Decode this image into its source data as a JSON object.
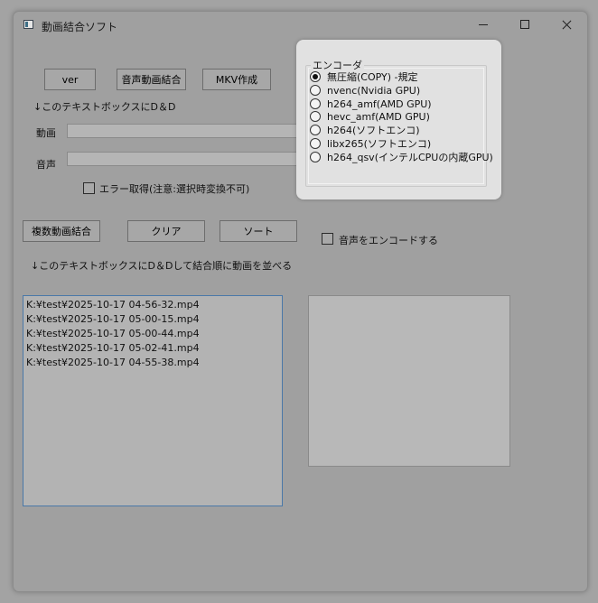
{
  "window": {
    "title": "動画結合ソフト",
    "icon": "app-window-icon"
  },
  "top_buttons": {
    "ver": "ver",
    "audio_video_merge": "音声動画結合",
    "mkv_create": "MKV作成"
  },
  "dnd_hint_1": "↓このテキストボックスにD＆D",
  "video_label": "動画",
  "audio_label": "音声",
  "video_path": "",
  "audio_path": "",
  "error_check_label": "エラー取得(注意:選択時変換不可)",
  "bottom_buttons": {
    "multi_merge": "複数動画結合",
    "clear": "クリア",
    "sort": "ソート"
  },
  "encode_audio_label": "音声をエンコードする",
  "dnd_hint_2": "↓このテキストボックスにD＆Dして結合順に動画を並べる",
  "file_list": [
    "K:¥test¥2025-10-17 04-56-32.mp4",
    "K:¥test¥2025-10-17 05-00-15.mp4",
    "K:¥test¥2025-10-17 05-00-44.mp4",
    "K:¥test¥2025-10-17 05-02-41.mp4",
    "K:¥test¥2025-10-17 04-55-38.mp4"
  ],
  "encoder": {
    "legend": "エンコーダ",
    "selected": 0,
    "options": [
      "無圧縮(COPY) -規定",
      "nvenc(Nvidia GPU)",
      "h264_amf(AMD GPU)",
      "hevc_amf(AMD GPU)",
      "h264(ソフトエンコ)",
      "libx265(ソフトエンコ)",
      "h264_qsv(インテルCPUの内蔵GPU)"
    ]
  },
  "colors": {
    "accent_border": "#4a78a8",
    "window_bg": "#a0a0a0",
    "panel_bg": "#e1e1e1"
  }
}
